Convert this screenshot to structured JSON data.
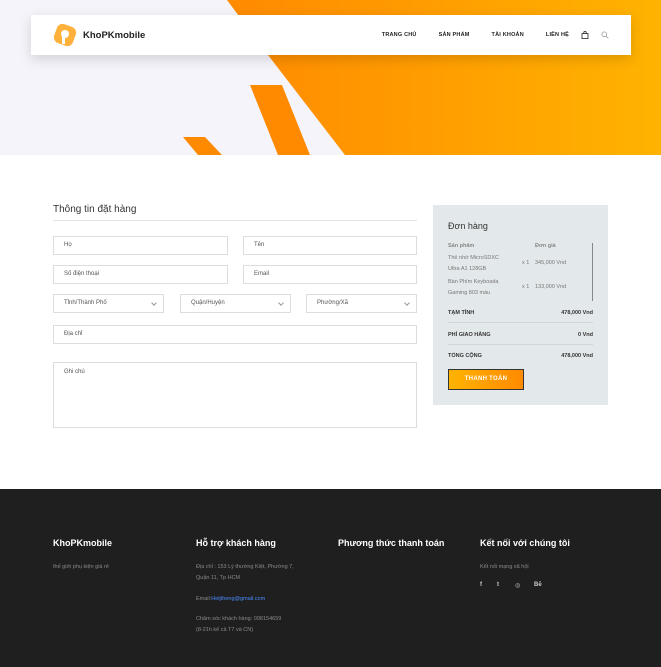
{
  "brand": {
    "name": "KhoPKmobile"
  },
  "nav": {
    "items": [
      "TRANG CHỦ",
      "SẢN PHẨM",
      "TÀI KHOẢN",
      "LIÊN HỆ"
    ],
    "cart_icon": "bag-icon",
    "search_icon": "search-icon"
  },
  "colors": {
    "accent": "#ff8a00",
    "accent_light": "#ffb300",
    "footer_bg": "#1f1f1f",
    "order_bg": "#e3e8ea"
  },
  "form": {
    "title": "Thông tin đặt hàng",
    "last_name": "Họ",
    "first_name": "Tên",
    "phone": "Số điện thoại",
    "email": "Email",
    "province": "Tỉnh/Thành Phố",
    "district": "Quận/Huyện",
    "ward": "Phường/Xã",
    "address": "Địa chỉ",
    "note": "Ghi chú"
  },
  "order": {
    "title": "Đơn hàng",
    "col_product": "Sản phẩm",
    "col_price": "Đơn giá",
    "items": [
      {
        "name_line1": "Thẻ nhớ MicroSDXC",
        "name_line2": "Ultra A1 128GB",
        "qty": "x 1",
        "price": "345,000 Vnd"
      },
      {
        "name_line1": "Bàn Phím Keyboada",
        "name_line2": "Gaming 803 màu",
        "qty": "x 1",
        "price": "133,000 Vnd"
      }
    ],
    "subtotal_label": "TẠM TÍNH",
    "subtotal": "478,000 Vnd",
    "shipping_label": "PHÍ GIAO HÀNG",
    "shipping": "0 Vnd",
    "total_label": "TỔNG CỘNG",
    "total": "478,000 Vnd",
    "pay_label": "THANH TOÁN"
  },
  "footer": {
    "col1": {
      "title": "KhoPKmobile",
      "text": "thế giới phụ kiện giá rẻ"
    },
    "col2": {
      "title": "Hỗ trợ khách hàng",
      "address_line1": "Địa chỉ : 153 Lý thường Kiệt, Phường 7,",
      "address_line2": "Quận 11, Tp HCM",
      "email_label": "Email:",
      "email": "Heljtheng@gmail.com",
      "care_line1": "Chăm sóc khách hàng: 098154659",
      "care_line2": "(8-21h kể cả T7 và CN)"
    },
    "col3": {
      "title": "Phương thức thanh toán"
    },
    "col4": {
      "title": "Kết nối với chúng tôi",
      "text": "Kết nối mạng xã hội",
      "social": [
        "f",
        "t",
        "◎",
        "Bē"
      ]
    }
  }
}
